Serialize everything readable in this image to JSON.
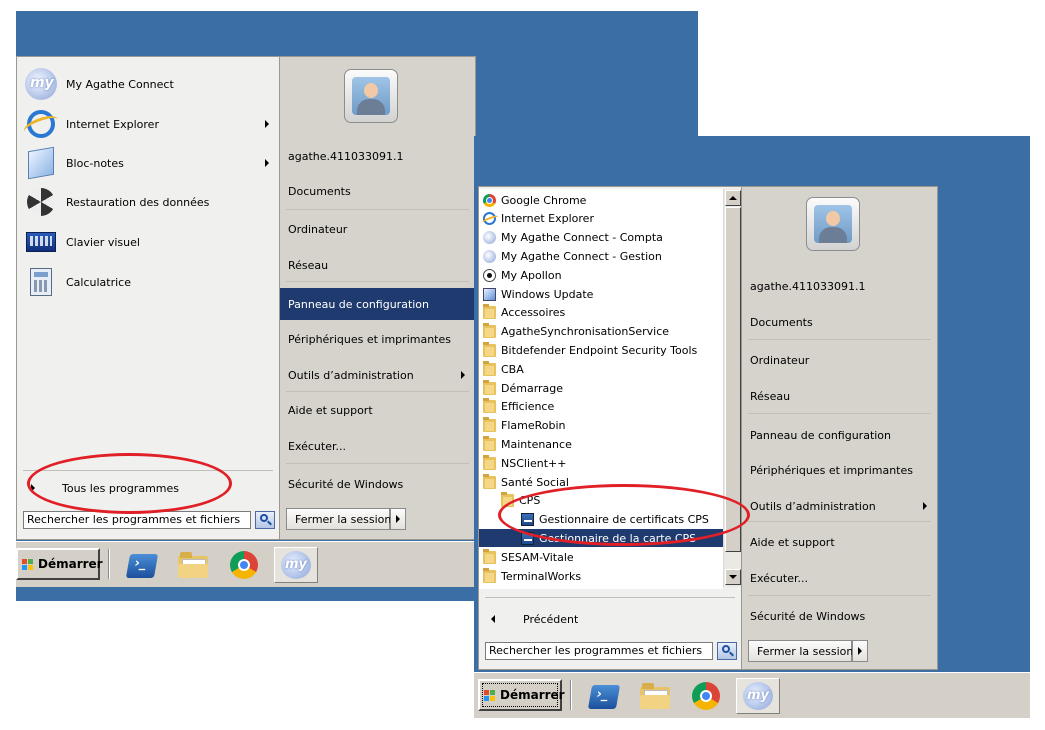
{
  "colors": {
    "desktop": "#3b6ea5",
    "selected": "#1f3a6e",
    "annotation": "#e01f26"
  },
  "left_screenshot": {
    "pinned_items": [
      {
        "label": "My Agathe Connect",
        "icon": "my-agathe-icon",
        "submenu": false
      },
      {
        "label": "Internet Explorer",
        "icon": "internet-explorer-icon",
        "submenu": true
      },
      {
        "label": "Bloc-notes",
        "icon": "notepad-icon",
        "submenu": true
      },
      {
        "label": "Restauration des données",
        "icon": "backup-restore-icon",
        "submenu": false
      },
      {
        "label": "Clavier visuel",
        "icon": "keyboard-icon",
        "submenu": false
      },
      {
        "label": "Calculatrice",
        "icon": "calculator-icon",
        "submenu": false
      }
    ],
    "all_programs": "Tous les programmes",
    "search_placeholder": "Rechercher les programmes et fichiers",
    "username": "agathe.411033091.1",
    "right_items": [
      {
        "label": "Documents",
        "submenu": false
      },
      {
        "label": "Ordinateur",
        "submenu": false
      },
      {
        "label": "Réseau",
        "submenu": false
      },
      {
        "label": "Panneau de configuration",
        "submenu": false,
        "selected": true
      },
      {
        "label": "Périphériques et imprimantes",
        "submenu": false
      },
      {
        "label": "Outils d’administration",
        "submenu": true
      },
      {
        "label": "Aide et support",
        "submenu": false
      },
      {
        "label": "Exécuter...",
        "submenu": false
      },
      {
        "label": "Sécurité de Windows",
        "submenu": false
      }
    ],
    "logoff": "Fermer la session",
    "start": "Démarrer"
  },
  "right_screenshot": {
    "programs": [
      {
        "label": "Google Chrome",
        "icon": "chrome-icon",
        "indent": 0
      },
      {
        "label": "Internet Explorer",
        "icon": "ie-icon",
        "indent": 0
      },
      {
        "label": "My Agathe Connect - Compta",
        "icon": "my-icon",
        "indent": 0
      },
      {
        "label": "My Agathe Connect - Gestion",
        "icon": "my-icon",
        "indent": 0
      },
      {
        "label": "My Apollon",
        "icon": "apollon-icon",
        "indent": 0
      },
      {
        "label": "Windows Update",
        "icon": "windows-update-icon",
        "indent": 0
      },
      {
        "label": "Accessoires",
        "icon": "folder-icon",
        "indent": 0
      },
      {
        "label": "AgatheSynchronisationService",
        "icon": "folder-icon",
        "indent": 0
      },
      {
        "label": "Bitdefender Endpoint Security Tools",
        "icon": "folder-icon",
        "indent": 0
      },
      {
        "label": "CBA",
        "icon": "folder-icon",
        "indent": 0
      },
      {
        "label": "Démarrage",
        "icon": "folder-icon",
        "indent": 0
      },
      {
        "label": "Efficience",
        "icon": "folder-icon",
        "indent": 0
      },
      {
        "label": "FlameRobin",
        "icon": "folder-icon",
        "indent": 0
      },
      {
        "label": "Maintenance",
        "icon": "folder-icon",
        "indent": 0
      },
      {
        "label": "NSClient++",
        "icon": "folder-icon",
        "indent": 0
      },
      {
        "label": "Santé Social",
        "icon": "folder-icon",
        "indent": 0
      },
      {
        "label": "CPS",
        "icon": "folder-icon",
        "indent": 1
      },
      {
        "label": "Gestionnaire de certificats CPS",
        "icon": "cps-icon",
        "indent": 2
      },
      {
        "label": "Gestionnaire de la carte CPS",
        "icon": "cps-icon",
        "indent": 2,
        "selected": true
      },
      {
        "label": "SESAM-Vitale",
        "icon": "folder-icon",
        "indent": 0
      },
      {
        "label": "TerminalWorks",
        "icon": "folder-icon",
        "indent": 0
      }
    ],
    "back": "Précédent",
    "search_placeholder": "Rechercher les programmes et fichiers",
    "username": "agathe.411033091.1",
    "right_items": [
      {
        "label": "Documents",
        "submenu": false
      },
      {
        "label": "Ordinateur",
        "submenu": false
      },
      {
        "label": "Réseau",
        "submenu": false
      },
      {
        "label": "Panneau de configuration",
        "submenu": false
      },
      {
        "label": "Périphériques et imprimantes",
        "submenu": false
      },
      {
        "label": "Outils d’administration",
        "submenu": true
      },
      {
        "label": "Aide et support",
        "submenu": false
      },
      {
        "label": "Exécuter...",
        "submenu": false
      },
      {
        "label": "Sécurité de Windows",
        "submenu": false
      }
    ],
    "logoff": "Fermer la session",
    "start": "Démarrer"
  }
}
